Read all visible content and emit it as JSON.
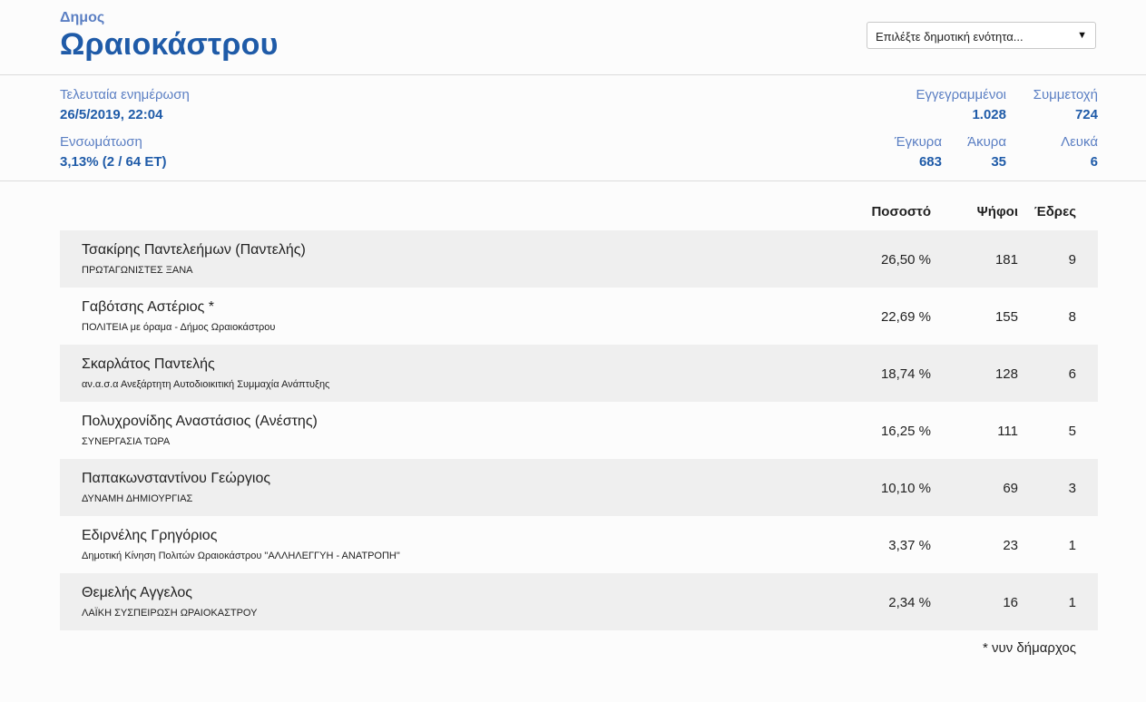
{
  "header": {
    "label": "Δημος",
    "name": "Ωραιοκάστρου",
    "select": {
      "value": "Επιλέξτε δημοτική ενότητα...",
      "arrow": "▼"
    }
  },
  "stats": {
    "last_update": {
      "label": "Τελευταία ενημέρωση",
      "value": "26/5/2019, 22:04"
    },
    "integration": {
      "label": "Ενσωμάτωση",
      "value": "3,13% (2 / 64 ΕΤ)"
    },
    "registered": {
      "label": "Εγγεγραμμένοι",
      "value": "1.028"
    },
    "turnout": {
      "label": "Συμμετοχή",
      "value": "724"
    },
    "valid": {
      "label": "Έγκυρα",
      "value": "683"
    },
    "invalid": {
      "label": "Άκυρα",
      "value": "35"
    },
    "blank": {
      "label": "Λευκά",
      "value": "6"
    }
  },
  "table": {
    "headers": {
      "percent": "Ποσοστό",
      "votes": "Ψήφοι",
      "seats": "Έδρες"
    },
    "rows": [
      {
        "name": "Τσακίρης Παντελεήμων (Παντελής)",
        "party": "ΠΡΩΤΑΓΩΝΙΣΤΕΣ ΞΑΝΑ",
        "percent": "26,50 %",
        "votes": "181",
        "seats": "9"
      },
      {
        "name": "Γαβότσης Αστέριος *",
        "party": "ΠΟΛΙΤΕΙΑ με όραμα - Δήμος Ωραιοκάστρου",
        "percent": "22,69 %",
        "votes": "155",
        "seats": "8"
      },
      {
        "name": "Σκαρλάτος Παντελής",
        "party": "αν.α.σ.α Ανεξάρτητη Αυτοδιοικιτική Συμμαχία Ανάπτυξης",
        "percent": "18,74 %",
        "votes": "128",
        "seats": "6"
      },
      {
        "name": "Πολυχρονίδης Αναστάσιος (Ανέστης)",
        "party": "ΣΥΝΕΡΓΑΣΙΑ ΤΩΡΑ",
        "percent": "16,25 %",
        "votes": "111",
        "seats": "5"
      },
      {
        "name": "Παπακωνσταντίνου Γεώργιος",
        "party": "ΔΥΝΑΜΗ ΔΗΜΙΟΥΡΓΙΑΣ",
        "percent": "10,10 %",
        "votes": "69",
        "seats": "3"
      },
      {
        "name": "Εδιρνέλης Γρηγόριος",
        "party": "Δημοτική Κίνηση Πολιτών Ωραιοκάστρου \"ΑΛΛΗΛΕΓΓΥΗ - ΑΝΑΤΡΟΠΗ\"",
        "percent": "3,37 %",
        "votes": "23",
        "seats": "1"
      },
      {
        "name": "Θεμελής Αγγελος",
        "party": "ΛΑΪΚΗ ΣΥΣΠΕΙΡΩΣΗ ΩΡΑΙΟΚΑΣΤΡΟΥ",
        "percent": "2,34 %",
        "votes": "16",
        "seats": "1"
      }
    ]
  },
  "footnote": "* νυν δήμαρχος"
}
